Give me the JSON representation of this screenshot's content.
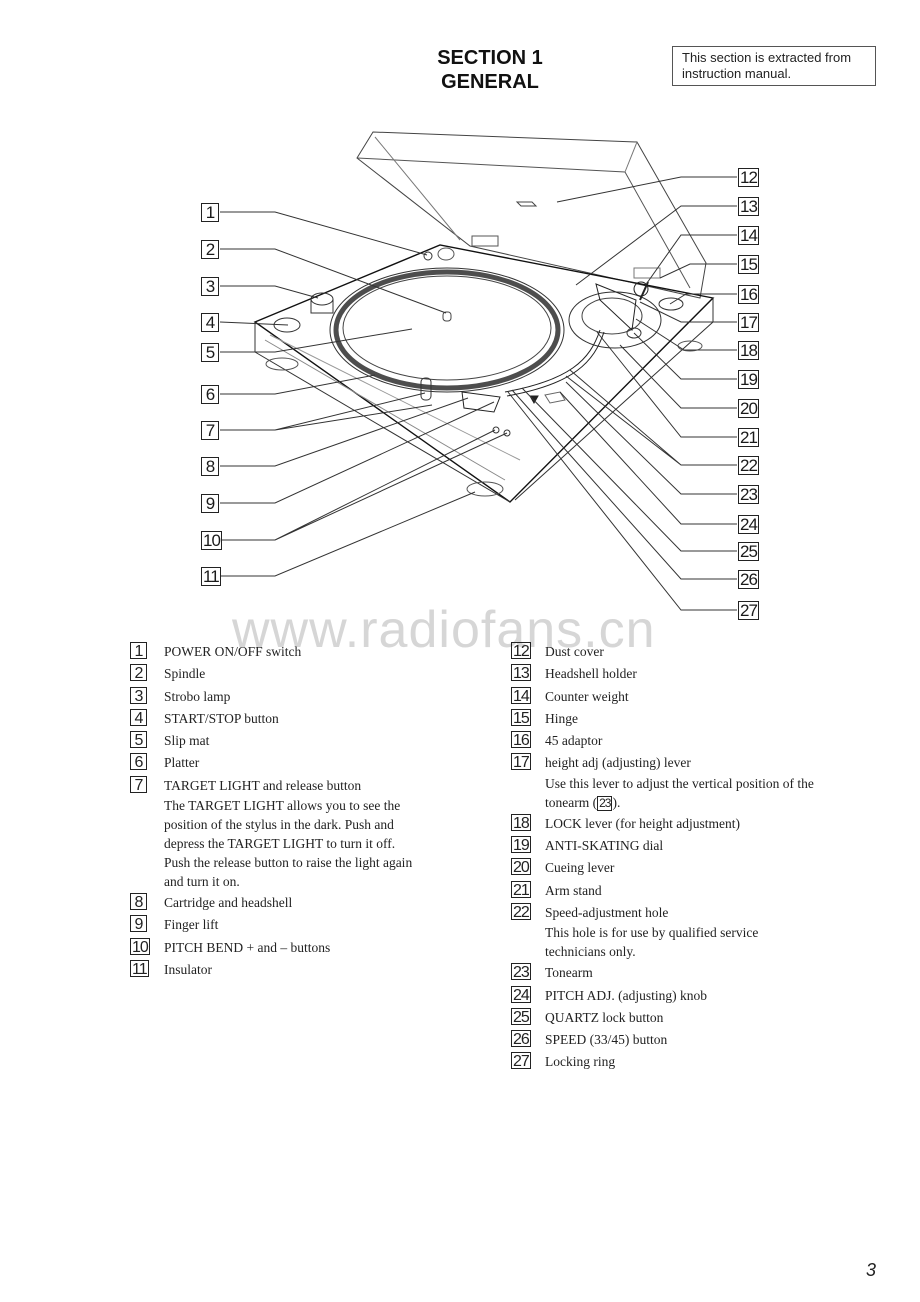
{
  "header": {
    "section": "SECTION 1",
    "title": "GENERAL",
    "note": "This section is extracted from instruction manual."
  },
  "watermark": "www.radiofans.cn",
  "diagram": {
    "subject": "turntable-with-dust-cover",
    "callouts_left": [
      "1",
      "2",
      "3",
      "4",
      "5",
      "6",
      "7",
      "8",
      "9",
      "10",
      "11"
    ],
    "callouts_right": [
      "12",
      "13",
      "14",
      "15",
      "16",
      "17",
      "18",
      "19",
      "20",
      "21",
      "22",
      "23",
      "24",
      "25",
      "26",
      "27"
    ]
  },
  "legend_left": [
    {
      "num": "1",
      "label": "POWER ON/OFF switch"
    },
    {
      "num": "2",
      "label": "Spindle"
    },
    {
      "num": "3",
      "label": "Strobo lamp"
    },
    {
      "num": "4",
      "label": "START/STOP button"
    },
    {
      "num": "5",
      "label": "Slip mat"
    },
    {
      "num": "6",
      "label": "Platter"
    },
    {
      "num": "7",
      "label": "TARGET LIGHT and release button",
      "desc": [
        "The TARGET LIGHT allows you to see the",
        "position of the stylus in the dark. Push and",
        "depress the TARGET LIGHT to turn it off.",
        "Push the release button to raise the light again",
        "and turn it on."
      ]
    },
    {
      "num": "8",
      "label": "Cartridge and headshell"
    },
    {
      "num": "9",
      "label": "Finger lift"
    },
    {
      "num": "10",
      "label": "PITCH BEND + and – buttons"
    },
    {
      "num": "11",
      "label": "Insulator"
    }
  ],
  "legend_right": [
    {
      "num": "12",
      "label": "Dust cover"
    },
    {
      "num": "13",
      "label": "Headshell holder"
    },
    {
      "num": "14",
      "label": "Counter weight"
    },
    {
      "num": "15",
      "label": "Hinge"
    },
    {
      "num": "16",
      "label": "45 adaptor"
    },
    {
      "num": "17",
      "label": "height adj (adjusting) lever",
      "desc": [
        "Use this lever to adjust the vertical position of the"
      ],
      "desc_tail": {
        "prefix": "tonearm (",
        "ref": "23",
        "suffix": ")."
      }
    },
    {
      "num": "18",
      "label": "LOCK lever (for height adjustment)"
    },
    {
      "num": "19",
      "label": "ANTI-SKATING dial"
    },
    {
      "num": "20",
      "label": "Cueing lever"
    },
    {
      "num": "21",
      "label": "Arm stand"
    },
    {
      "num": "22",
      "label": "Speed-adjustment hole",
      "desc": [
        "This hole is for use by qualified service",
        "technicians only."
      ]
    },
    {
      "num": "23",
      "label": "Tonearm"
    },
    {
      "num": "24",
      "label": "PITCH ADJ. (adjusting) knob"
    },
    {
      "num": "25",
      "label": "QUARTZ lock button"
    },
    {
      "num": "26",
      "label": "SPEED (33/45) button"
    },
    {
      "num": "27",
      "label": "Locking ring"
    }
  ],
  "footer": {
    "page_number": "3"
  }
}
